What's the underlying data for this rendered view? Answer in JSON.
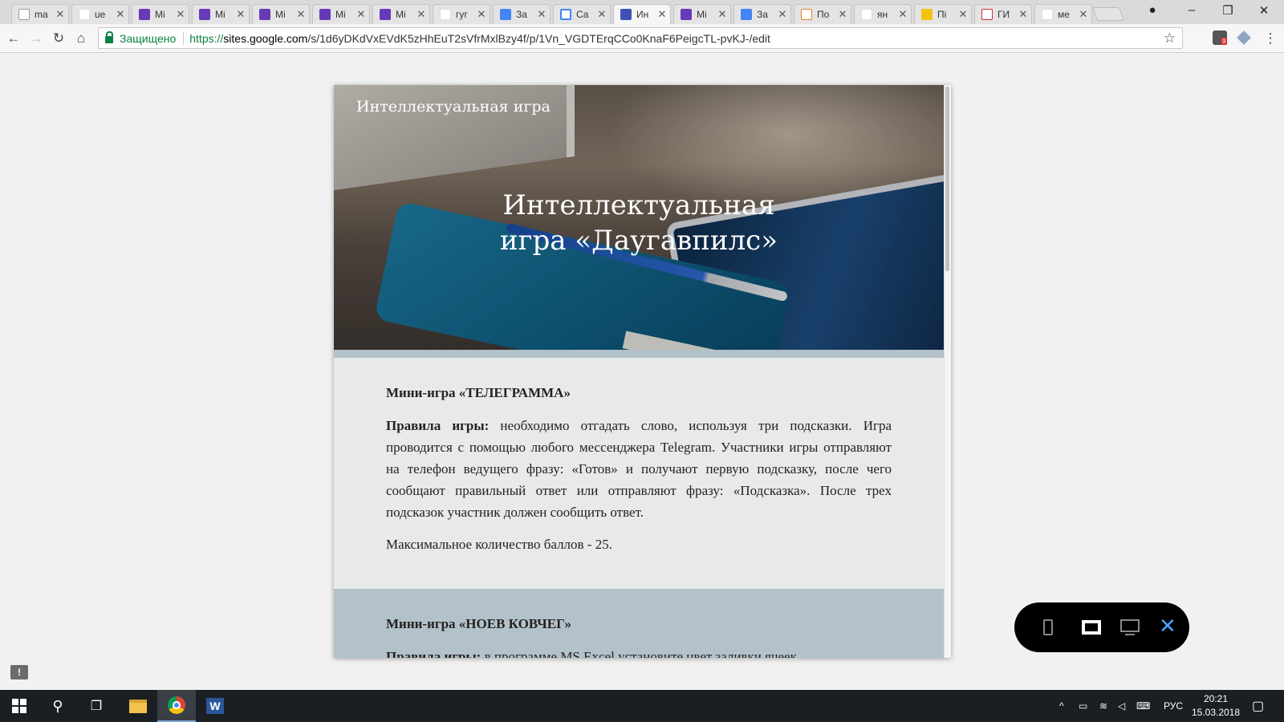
{
  "browser": {
    "tabs": [
      {
        "title": "ma",
        "icon": "doc-icon",
        "fav": "fav-doc"
      },
      {
        "title": "ue",
        "icon": "google-icon",
        "fav": "fav-g"
      },
      {
        "title": "Mi",
        "icon": "forms-icon",
        "fav": "fav-form"
      },
      {
        "title": "Mi",
        "icon": "forms-icon",
        "fav": "fav-form"
      },
      {
        "title": "Mi",
        "icon": "forms-icon",
        "fav": "fav-form"
      },
      {
        "title": "Mi",
        "icon": "forms-icon",
        "fav": "fav-form"
      },
      {
        "title": "Mi",
        "icon": "forms-icon",
        "fav": "fav-form"
      },
      {
        "title": "гуг",
        "icon": "google-icon",
        "fav": "fav-g"
      },
      {
        "title": "За",
        "icon": "docs-icon",
        "fav": "fav-docs"
      },
      {
        "title": "Са",
        "icon": "sites-icon",
        "fav": "fav-sites"
      },
      {
        "title": "Ин",
        "icon": "sites-icon",
        "fav": "fav-sites-dark",
        "active": true
      },
      {
        "title": "Mi",
        "icon": "forms-icon",
        "fav": "fav-form"
      },
      {
        "title": "За",
        "icon": "docs-icon",
        "fav": "fav-docs"
      },
      {
        "title": "По",
        "icon": "mail-icon",
        "fav": "fav-mail"
      },
      {
        "title": "ян",
        "icon": "google-icon",
        "fav": "fav-g"
      },
      {
        "title": "Пі",
        "icon": "yandex-mail-icon",
        "fav": "fav-yan"
      },
      {
        "title": "ГИ",
        "icon": "pdf-icon",
        "fav": "fav-pdf"
      },
      {
        "title": "ме",
        "icon": "google-icon",
        "fav": "fav-g"
      }
    ],
    "secure_label": "Защищено",
    "url_scheme": "https://",
    "url_host": "sites.google.com",
    "url_path": "/s/1d6yDKdVxEVdK5zHhEuT2sVfrMxlBzy4f/p/1Vn_VGDTErqCCo0KnaF6PeigcTL-pvKJ-/edit",
    "extension_badge": "9"
  },
  "site": {
    "name": "Интеллектуальная игра",
    "hero_title_line1": "Интеллектуальная",
    "hero_title_line2": "игра «Даугавпилс»"
  },
  "section1": {
    "heading": "Мини-игра «ТЕЛЕГРАММА»",
    "rules_label": "Правила игры:",
    "rules_text": " необходимо отгадать слово, используя три подсказки. Игра проводится с помощью любого мессенджера Telegram. Участники игры отправляют на телефон ведущего фразу: «Готов» и получают первую подсказку, после чего сообщают правильный ответ или отправляют фразу: «Подсказка». После трех подсказок участник должен сообщить ответ.",
    "max_score": "Максимальное количество баллов - 25."
  },
  "section2": {
    "heading": "Мини-игра «НОЕВ КОВЧЕГ»",
    "rules_label": "Правила игры:",
    "rules_text": " в программе MS Excel установите цвет заливки ячеек."
  },
  "switcher": {
    "close_glyph": "✕"
  },
  "taskbar": {
    "language": "РУС",
    "time": "20:21",
    "date": "15.03.2018"
  },
  "colors": {
    "accent_blue": "#4aa3ff",
    "section_band": "#b3c1ca",
    "secure_green": "#0b8043"
  }
}
